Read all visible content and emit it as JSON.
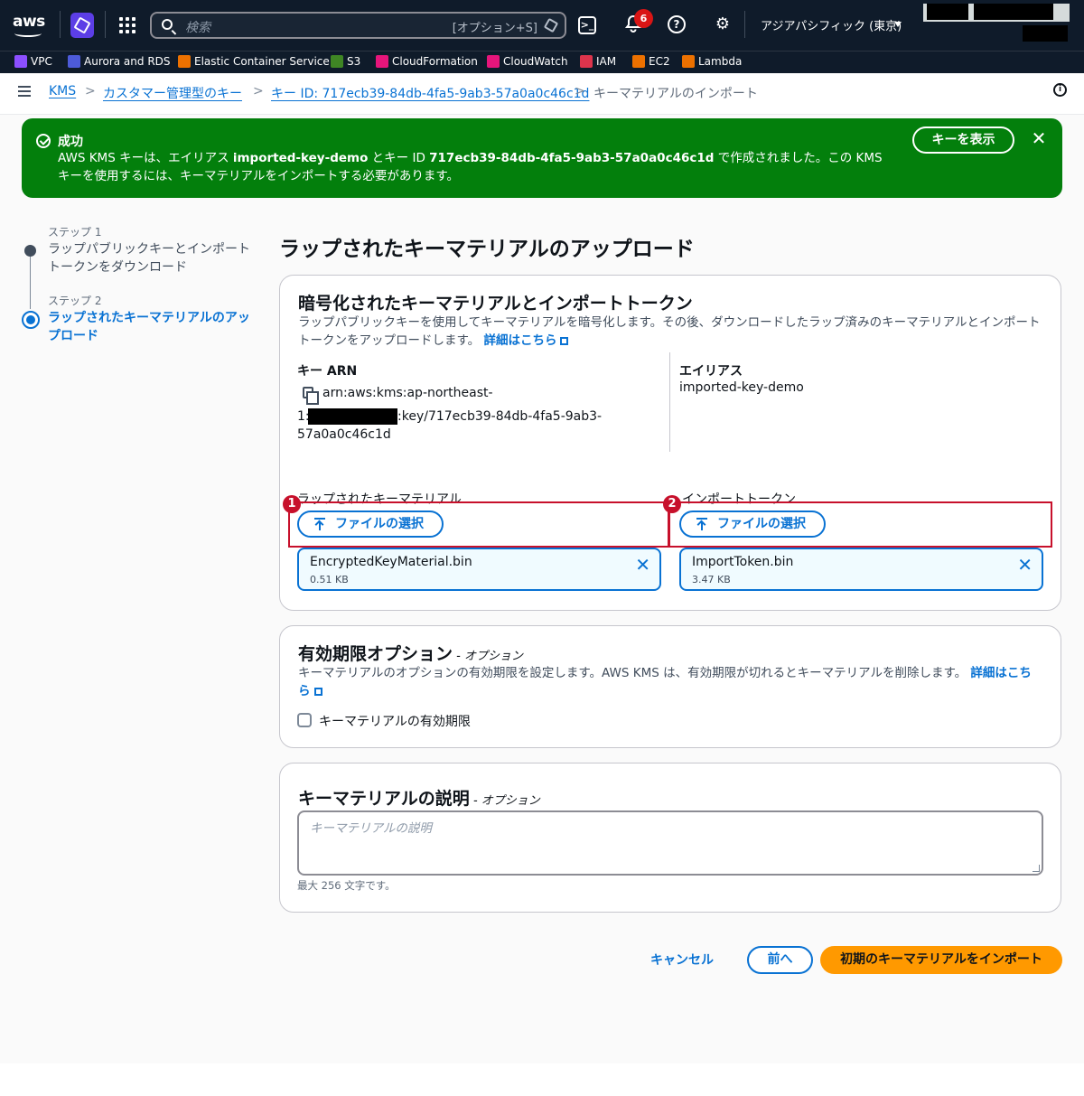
{
  "topnav": {
    "logo_text": "aws",
    "search_placeholder": "検索",
    "search_shortcut": "[オプション+S]",
    "cloudshell_glyph": ">_",
    "notifications_count": "6",
    "help_glyph": "?",
    "gear_glyph": "⚙",
    "region": "アジアパシフィック (東京)"
  },
  "favorites": [
    {
      "label": "VPC",
      "color": "#8c4fff",
      "icon": "vpc-icon"
    },
    {
      "label": "Aurora and RDS",
      "color": "#4d5bd9",
      "icon": "rds-icon"
    },
    {
      "label": "Elastic Container Service",
      "color": "#ed7100",
      "icon": "ecs-icon"
    },
    {
      "label": "S3",
      "color": "#3f8624",
      "icon": "s3-icon"
    },
    {
      "label": "CloudFormation",
      "color": "#e7157b",
      "icon": "cloudformation-icon"
    },
    {
      "label": "CloudWatch",
      "color": "#e7157b",
      "icon": "cloudwatch-icon"
    },
    {
      "label": "IAM",
      "color": "#dd344c",
      "icon": "iam-icon"
    },
    {
      "label": "EC2",
      "color": "#ed7100",
      "icon": "ec2-icon"
    },
    {
      "label": "Lambda",
      "color": "#ed7100",
      "icon": "lambda-icon"
    }
  ],
  "breadcrumb": {
    "items": [
      "KMS",
      "カスタマー管理型のキー",
      "キー ID: 717ecb39-84db-4fa5-9ab3-57a0a0c46c1d",
      "キーマテリアルのインポート"
    ],
    "separator": ">"
  },
  "flash": {
    "title": "成功",
    "msg_part1": "AWS KMS キーは、エイリアス ",
    "alias": "imported-key-demo",
    "msg_part2": " とキー ID ",
    "key_id": "717ecb39-84db-4fa5-9ab3-57a0a0c46c1d",
    "msg_part3": " で作成されました。この KMS キーを使用するには、キーマテリアルをインポートする必要があります。",
    "view_button": "キーを表示",
    "close_glyph": "✕",
    "color": "#037f0c"
  },
  "steps": [
    {
      "label": "ステップ 1",
      "text": "ラップパブリックキーとインポートトークンをダウンロード"
    },
    {
      "label": "ステップ 2",
      "text": "ラップされたキーマテリアルのアップロード"
    }
  ],
  "page_title": "ラップされたキーマテリアルのアップロード",
  "section1": {
    "heading": "暗号化されたキーマテリアルとインポートトークン",
    "description": "ラップパブリックキーを使用してキーマテリアルを暗号化します。その後、ダウンロードしたラップ済みのキーマテリアルとインポートトークンをアップロードします。",
    "learn_more": "詳細はこちら",
    "arn_label": "キー ARN",
    "arn_line1": "arn:aws:kms:ap-northeast-",
    "arn_line2_prefix": "1:",
    "arn_line2_suffix": ":key/717ecb39-84db-4fa5-9ab3-",
    "arn_line3": "57a0a0c46c1d",
    "alias_label": "エイリアス",
    "alias_value": "imported-key-demo",
    "wrapped_label": "ラップされたキーマテリアル",
    "token_label": "インポートトークン",
    "choose_file": "ファイルの選択",
    "file1_name": "EncryptedKeyMaterial.bin",
    "file1_size": "0.51 KB",
    "file2_name": "ImportToken.bin",
    "file2_size": "3.47 KB",
    "marker1": "1",
    "marker2": "2",
    "remove_glyph": "✕"
  },
  "section2": {
    "heading": "有効期限オプション",
    "optional": " - オプション",
    "description": "キーマテリアルのオプションの有効期限を設定します。AWS KMS は、有効期限が切れるとキーマテリアルを削除します。",
    "learn_more": "詳細はこちら",
    "checkbox_label": "キーマテリアルの有効期限",
    "checkbox_checked": false
  },
  "section3": {
    "heading": "キーマテリアルの説明",
    "optional": " - オプション",
    "placeholder": "キーマテリアルの説明",
    "hint": "最大 256 文字です。"
  },
  "actions": {
    "cancel": "キャンセル",
    "previous": "前へ",
    "submit": "初期のキーマテリアルをインポート",
    "submit_color": "#ff9900"
  }
}
